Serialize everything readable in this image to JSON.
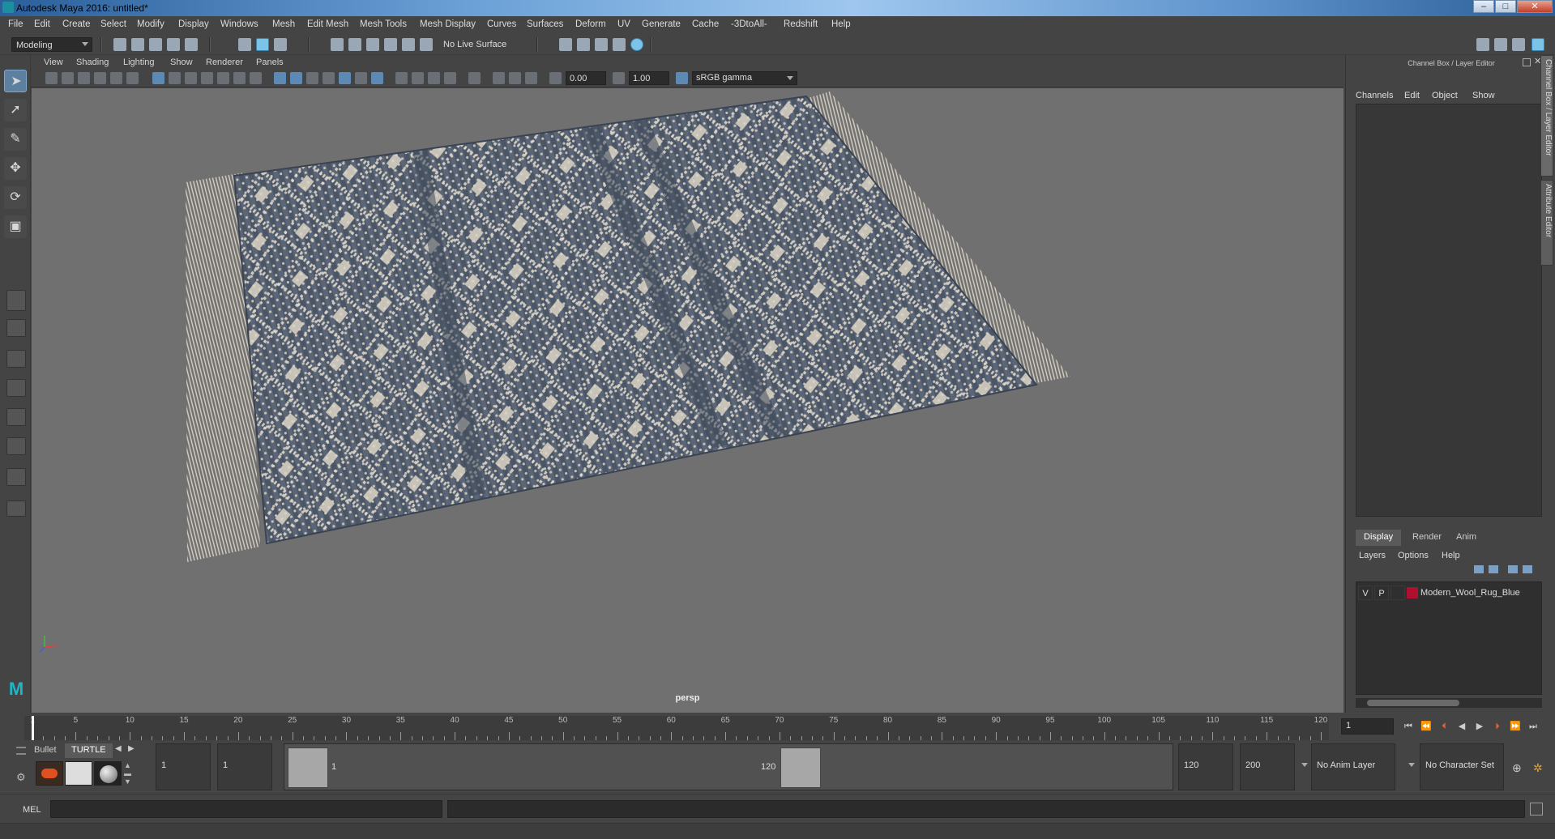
{
  "window": {
    "title": "Autodesk Maya 2016: untitled*"
  },
  "menubar": {
    "items": [
      "File",
      "Edit",
      "Create",
      "Select",
      "Modify",
      "Display",
      "Windows",
      "Mesh",
      "Edit Mesh",
      "Mesh Tools",
      "Mesh Display",
      "Curves",
      "Surfaces",
      "Deform",
      "UV",
      "Generate",
      "Cache",
      "-3DtoAll-",
      "Redshift",
      "Help"
    ]
  },
  "statusline": {
    "menuset": "Modeling",
    "live_surface": "No Live Surface"
  },
  "viewport": {
    "menus": [
      "View",
      "Shading",
      "Lighting",
      "Show",
      "Renderer",
      "Panels"
    ],
    "exposure": "0.00",
    "gamma": "1.00",
    "color_space": "sRGB gamma",
    "camera": "persp"
  },
  "rightpanel": {
    "title": "Channel Box / Layer Editor",
    "channel_tabs": [
      "Channels",
      "Edit",
      "Object",
      "Show"
    ],
    "layer_tabs": [
      "Display",
      "Render",
      "Anim"
    ],
    "layer_menus": [
      "Layers",
      "Options",
      "Help"
    ],
    "layer": {
      "v": "V",
      "p": "P",
      "name": "Modern_Wool_Rug_Blue",
      "color": "#b01030"
    },
    "side_tabs": [
      "Channel Box / Layer Editor",
      "Attribute Editor"
    ]
  },
  "timeslider": {
    "ticks": [
      "1",
      "5",
      "10",
      "15",
      "20",
      "25",
      "30",
      "35",
      "40",
      "45",
      "50",
      "55",
      "60",
      "65",
      "70",
      "75",
      "80",
      "85",
      "90",
      "95",
      "100",
      "105",
      "110",
      "115",
      "120"
    ],
    "current_frame": "1"
  },
  "rangeslider": {
    "shelf_tabs": [
      "Bullet",
      "TURTLE"
    ],
    "start_min": "1",
    "start": "1",
    "range_start_label": "1",
    "range_end_label": "120",
    "end": "120",
    "end_max": "200",
    "anim_layer": "No Anim Layer",
    "character_set": "No Character Set"
  },
  "cmdline": {
    "label": "MEL"
  }
}
